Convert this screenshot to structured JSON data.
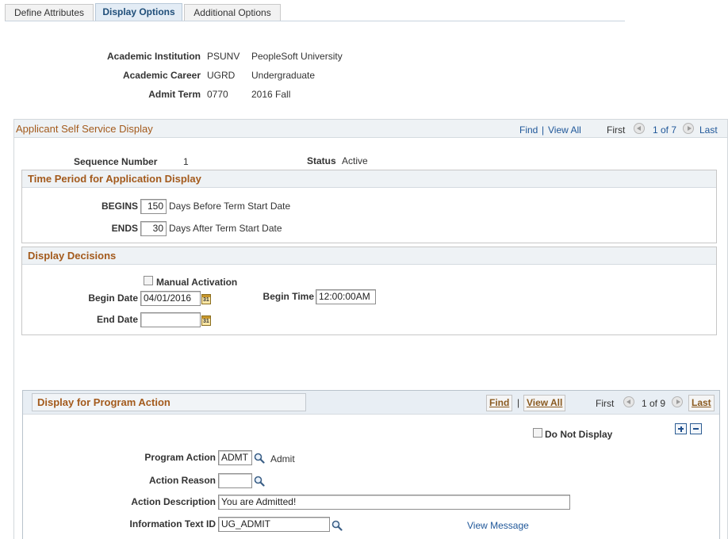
{
  "tabs": [
    {
      "label": "Define Attributes"
    },
    {
      "label": "Display Options"
    },
    {
      "label": "Additional Options"
    }
  ],
  "header": {
    "institution": {
      "label": "Academic Institution",
      "code": "PSUNV",
      "desc": "PeopleSoft University"
    },
    "career": {
      "label": "Academic Career",
      "code": "UGRD",
      "desc": "Undergraduate"
    },
    "term": {
      "label": "Admit Term",
      "code": "0770",
      "desc": "2016 Fall"
    }
  },
  "ss_display": {
    "title": "Applicant Self Service Display",
    "nav": {
      "find": "Find",
      "sep": "|",
      "view_all": "View All",
      "first": "First",
      "count": "1 of 7",
      "last": "Last"
    },
    "sequence": {
      "label": "Sequence Number",
      "value": "1"
    },
    "status": {
      "label": "Status",
      "value": "Active"
    }
  },
  "time_period": {
    "title": "Time Period for Application Display",
    "begins": {
      "label": "BEGINS",
      "value": "150",
      "suffix": "Days Before Term Start Date"
    },
    "ends": {
      "label": "ENDS",
      "value": "30",
      "suffix": "Days After Term Start Date"
    }
  },
  "decisions": {
    "title": "Display Decisions",
    "manual_activation": {
      "label": "Manual Activation",
      "checked": false
    },
    "begin_date": {
      "label": "Begin Date",
      "value": "04/01/2016"
    },
    "begin_time": {
      "label": "Begin Time",
      "value": "12:00:00AM"
    },
    "end_date": {
      "label": "End Date",
      "value": ""
    },
    "calendar_glyph": "31"
  },
  "program_action": {
    "title": "Display for Program Action",
    "nav": {
      "find": "Find",
      "sep": "|",
      "view_all": "View All",
      "first": "First",
      "count": "1 of 9",
      "last": "Last"
    },
    "do_not_display": {
      "label": "Do Not Display",
      "checked": false
    },
    "action": {
      "label": "Program Action",
      "value": "ADMT",
      "desc": "Admit"
    },
    "reason": {
      "label": "Action Reason",
      "value": ""
    },
    "description": {
      "label": "Action Description",
      "value": "You are Admitted!"
    },
    "info_text": {
      "label": "Information Text ID",
      "value": "UG_ADMIT",
      "link": "View Message"
    }
  },
  "icons": {
    "lookup": "magnifier-icon",
    "calendar": "calendar-icon",
    "prev": "previous-arrow-icon",
    "next": "next-arrow-icon",
    "add": "plus-icon",
    "delete": "minus-icon"
  },
  "colors": {
    "section_title": "#a35a1c",
    "link": "#1f5799",
    "active_tab": "#e3ecf5",
    "header_band": "#eef2f5"
  }
}
